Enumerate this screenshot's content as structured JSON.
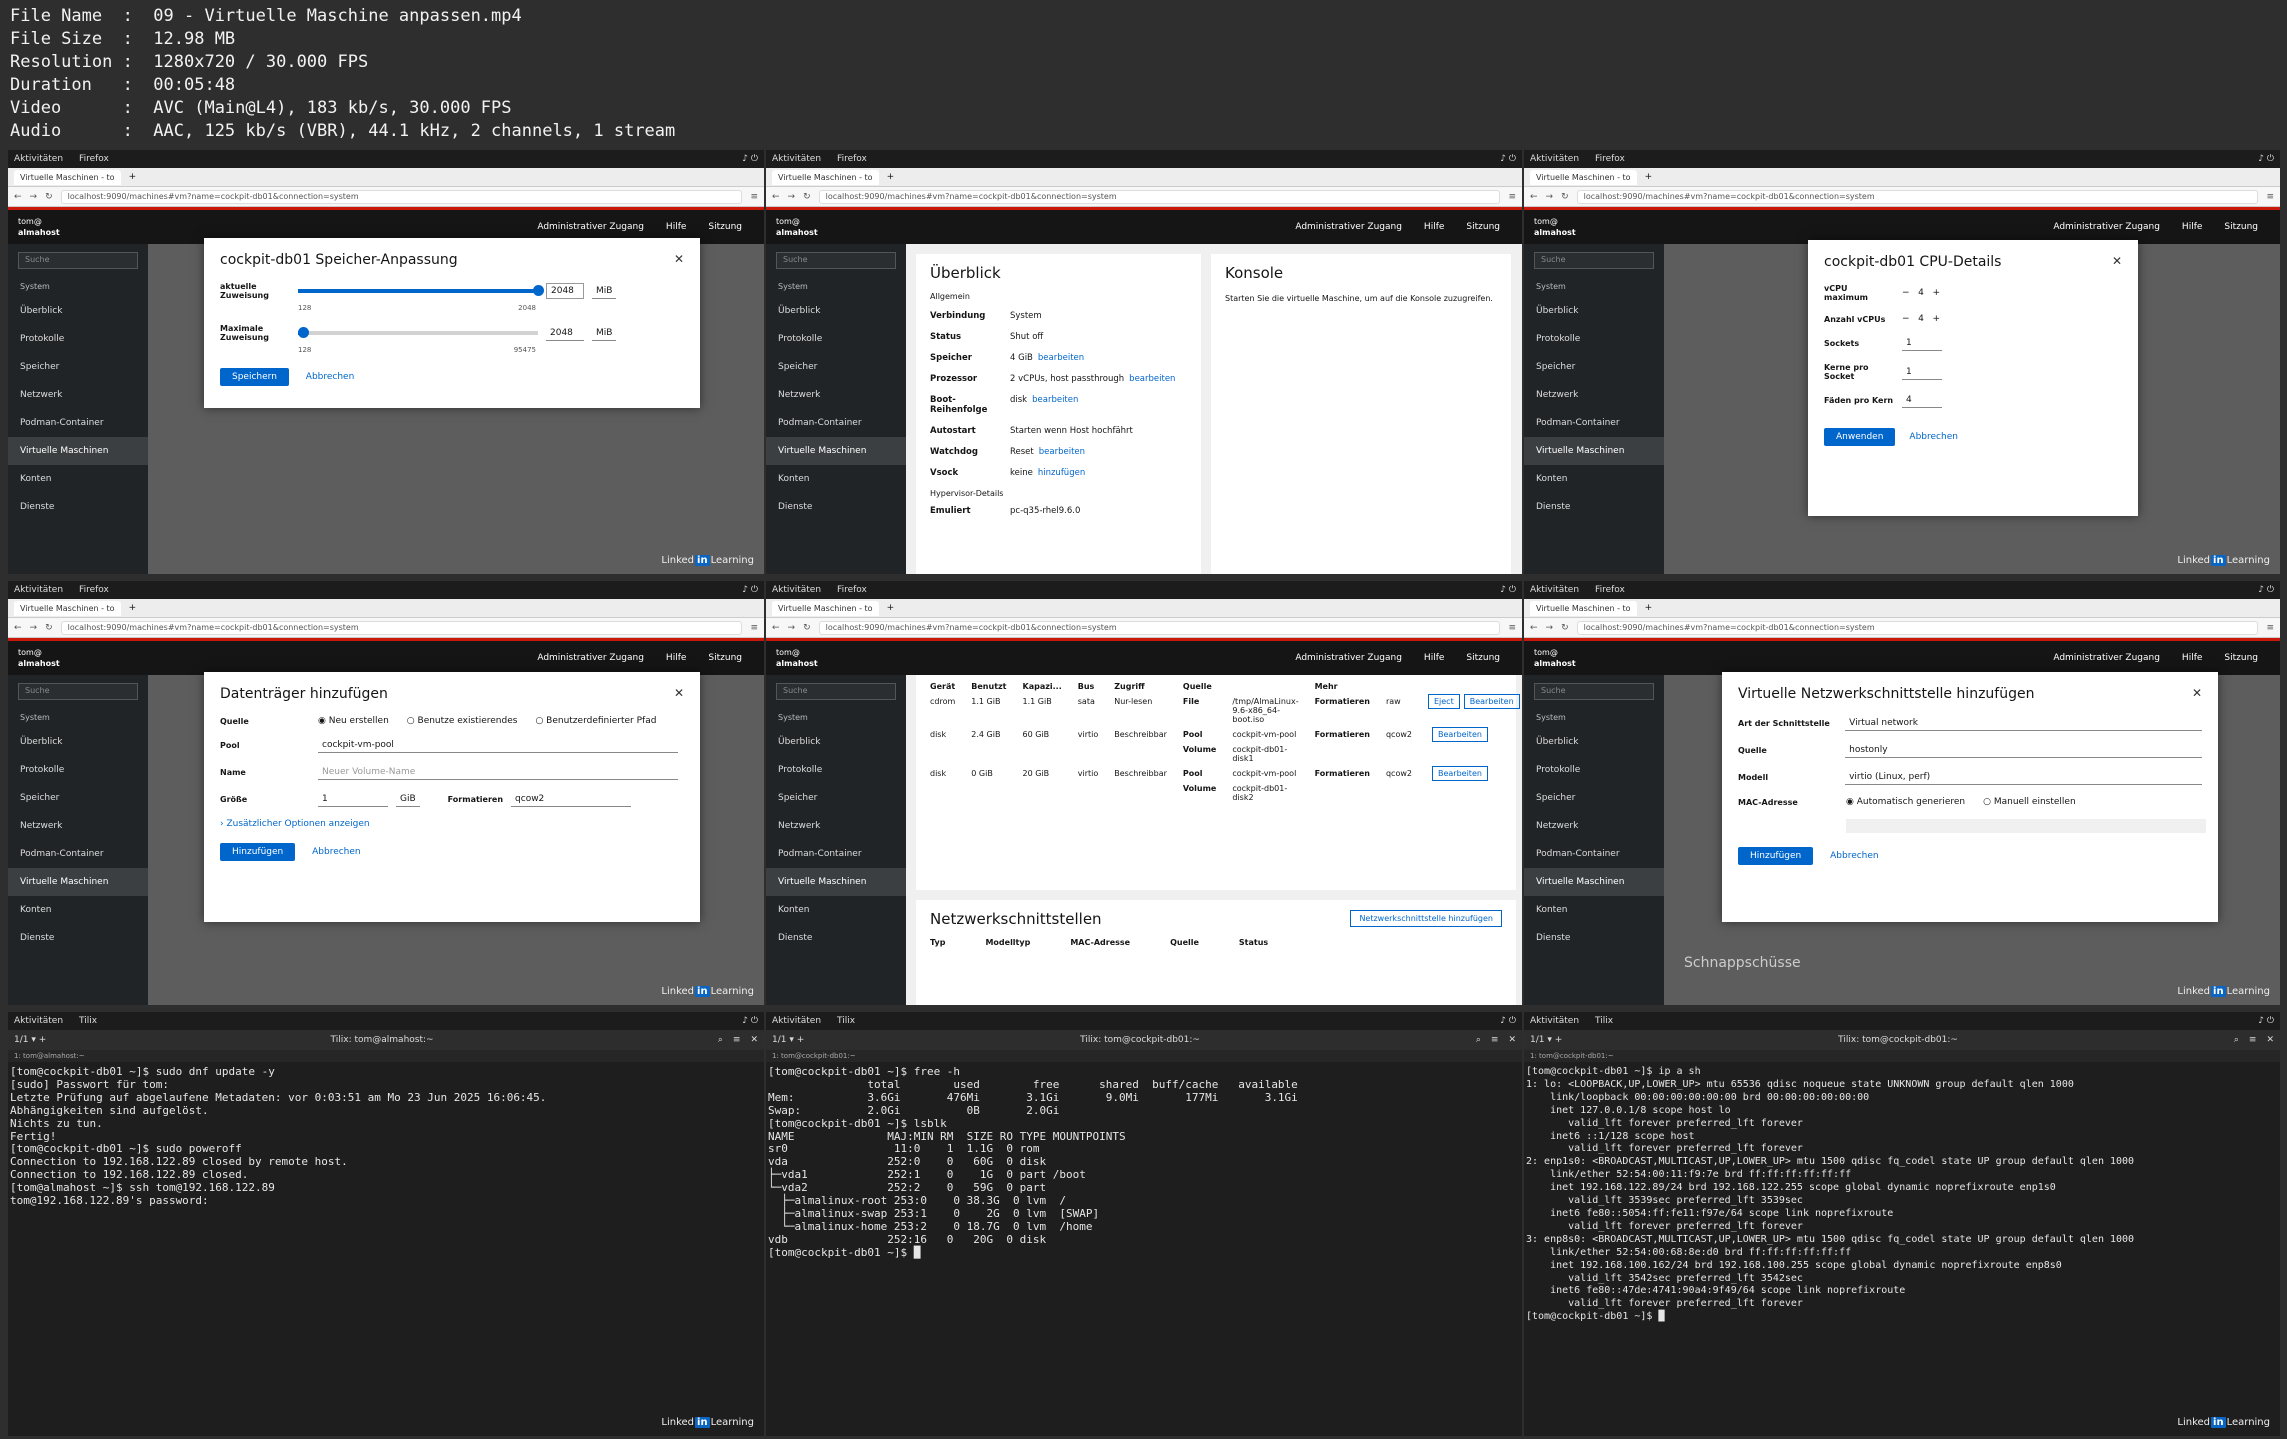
{
  "header": {
    "file_name": "File Name  :  09 - Virtuelle Maschine anpassen.mp4",
    "file_size": "File Size  :  12.98 MB",
    "resolution": "Resolution :  1280x720 / 30.000 FPS",
    "duration": "Duration   :  00:05:48",
    "video": "Video      :  AVC (Main@L4), 183 kb/s, 30.000 FPS",
    "audio": "Audio      :  AAC, 125 kb/s (VBR), 44.1 kHz, 2 channels, 1 stream"
  },
  "common": {
    "activities": "Aktivitäten",
    "firefox": "Firefox",
    "tilix": "Tilix",
    "tab": "Virtuelle Maschinen - to",
    "url": "localhost:9090/machines#vm?name=cockpit-db01&connection=system",
    "user": "tom@",
    "host": "almahost",
    "admin": "Administrativer Zugang",
    "help": "Hilfe",
    "session": "Sitzung",
    "search": "Suche",
    "linkedin": "Linked",
    "in": "in",
    "learning": "Learning",
    "sidebar": [
      "System",
      "Überblick",
      "Protokolle",
      "Speicher",
      "Netzwerk",
      "Podman-Container",
      "Virtuelle Maschinen",
      "Konten",
      "Dienste"
    ]
  },
  "t1": {
    "title": "cockpit-db01 Speicher-Anpassung",
    "current": "aktuelle Zuweisung",
    "current_min": "128",
    "current_max": "2048",
    "current_val": "2048",
    "unit": "MiB",
    "current_fraction": 0.998,
    "maximum": "Maximale Zuweisung",
    "max_min": "128",
    "max_max": "95475",
    "max_val": "2048",
    "max_fraction": 0.02,
    "save": "Speichern",
    "cancel": "Abbrechen"
  },
  "t2": {
    "overview": "Überblick",
    "general": "Allgemein",
    "console": "Konsole",
    "console_text": "Starten Sie die virtuelle Maschine, um auf die Konsole zuzugreifen.",
    "rows": [
      {
        "k": "Verbindung",
        "v": "System",
        "a": ""
      },
      {
        "k": "Status",
        "v": "Shut off",
        "a": ""
      },
      {
        "k": "Speicher",
        "v": "4 GiB",
        "a": "bearbeiten"
      },
      {
        "k": "Prozessor",
        "v": "2 vCPUs, host passthrough",
        "a": "bearbeiten"
      },
      {
        "k": "Boot-Reihenfolge",
        "v": "disk",
        "a": "bearbeiten"
      },
      {
        "k": "Autostart",
        "v": "Starten wenn Host hochfährt",
        "a": ""
      },
      {
        "k": "Watchdog",
        "v": "Reset",
        "a": "bearbeiten"
      },
      {
        "k": "Vsock",
        "v": "keine",
        "a": "hinzufügen"
      }
    ],
    "hyper": "Hypervisor-Details",
    "emul": "Emuliert",
    "emul_v": "pc-q35-rhel9.6.0"
  },
  "t3": {
    "title": "cockpit-db01 CPU-Details",
    "vcpu_max": "vCPU maximum",
    "vcpu_max_v": "4",
    "vcpus": "Anzahl vCPUs",
    "vcpus_v": "4",
    "sockets": "Sockets",
    "sockets_v": "1",
    "cores": "Kerne pro Socket",
    "cores_v": "1",
    "threads": "Fäden pro Kern",
    "threads_v": "4",
    "apply": "Anwenden",
    "cancel": "Abbrechen"
  },
  "t4": {
    "title": "Datenträger hinzufügen",
    "source": "Quelle",
    "opt1": "Neu erstellen",
    "opt2": "Benutze existierendes",
    "opt3": "Benutzerdefinierter Pfad",
    "pool": "Pool",
    "pool_v": "cockpit-vm-pool",
    "name": "Name",
    "name_ph": "Neuer Volume-Name",
    "size": "Größe",
    "size_v": "1",
    "size_unit": "GiB",
    "format": "Formatieren",
    "format_v": "qcow2",
    "more": "Zusätzlicher Optionen anzeigen",
    "add": "Hinzufügen",
    "cancel": "Abbrechen"
  },
  "t5": {
    "cols": [
      "Gerät",
      "Benutzt",
      "Kapazi...",
      "Bus",
      "Zugriff",
      "Quelle",
      "",
      "Mehr"
    ],
    "disks": [
      {
        "dev": "cdrom",
        "used": "1.1 GiB",
        "cap": "1.1 GiB",
        "bus": "sata",
        "acc": "Nur-lesen",
        "src": "File",
        "path": "/tmp/AlmaLinux-9.6-x86_64-boot.iso",
        "fmt": "raw",
        "btn": "Eject"
      },
      {
        "dev": "disk",
        "used": "2.4 GiB",
        "cap": "60 GiB",
        "bus": "virtio",
        "acc": "Beschreibbar",
        "src": "Pool",
        "path": "cockpit-vm-pool",
        "vol": "cockpit-db01-disk1",
        "fmt": "qcow2",
        "btn": ""
      },
      {
        "dev": "disk",
        "used": "0 GiB",
        "cap": "20 GiB",
        "bus": "virtio",
        "acc": "Beschreibbar",
        "src": "Pool",
        "path": "cockpit-vm-pool",
        "vol": "cockpit-db01-disk2",
        "fmt": "qcow2",
        "btn": ""
      }
    ],
    "volume": "Volume",
    "formatieren": "Formatieren",
    "edit": "Bearbeiten",
    "net": "Netzwerkschnittstellen",
    "net_btn": "Netzwerkschnittstelle hinzufügen",
    "net_cols": [
      "Typ",
      "Modelltyp",
      "MAC-Adresse",
      "Quelle",
      "Status"
    ]
  },
  "t6": {
    "title": "Virtuelle Netzwerkschnittstelle hinzufügen",
    "type": "Art der Schnittstelle",
    "type_v": "Virtual network",
    "source": "Quelle",
    "source_v": "hostonly",
    "model": "Modell",
    "model_v": "virtio (Linux, perf)",
    "mac": "MAC-Adresse",
    "mac_auto": "Automatisch generieren",
    "mac_man": "Manuell einstellen",
    "add": "Hinzufügen",
    "cancel": "Abbrechen",
    "snap": "Schnappschüsse"
  },
  "t7": {
    "title": "Tilix: tom@almahost:~",
    "tab": "1: tom@almahost:~",
    "lines": [
      "[tom@cockpit-db01 ~]$ sudo dnf update -y",
      "[sudo] Passwort für tom:",
      "Letzte Prüfung auf abgelaufene Metadaten: vor 0:03:51 am Mo 23 Jun 2025 16:06:45.",
      "Abhängigkeiten sind aufgelöst.",
      "Nichts zu tun.",
      "Fertig!",
      "[tom@cockpit-db01 ~]$ sudo poweroff",
      "Connection to 192.168.122.89 closed by remote host.",
      "Connection to 192.168.122.89 closed.",
      "[tom@almahost ~]$ ssh tom@192.168.122.89",
      "tom@192.168.122.89's password:"
    ]
  },
  "t8": {
    "title": "Tilix: tom@cockpit-db01:~",
    "tab": "1: tom@cockpit-db01:~",
    "lines": [
      "[tom@cockpit-db01 ~]$ free -h",
      "               total        used        free      shared  buff/cache   available",
      "Mem:           3.6Gi       476Mi       3.1Gi       9.0Mi       177Mi       3.1Gi",
      "Swap:          2.0Gi          0B       2.0Gi",
      "[tom@cockpit-db01 ~]$ lsblk",
      "NAME              MAJ:MIN RM  SIZE RO TYPE MOUNTPOINTS",
      "sr0                11:0    1  1.1G  0 rom",
      "vda               252:0    0   60G  0 disk",
      "├─vda1            252:1    0    1G  0 part /boot",
      "└─vda2            252:2    0   59G  0 part",
      "  ├─almalinux-root 253:0    0 38.3G  0 lvm  /",
      "  ├─almalinux-swap 253:1    0    2G  0 lvm  [SWAP]",
      "  └─almalinux-home 253:2    0 18.7G  0 lvm  /home",
      "vdb               252:16   0   20G  0 disk",
      "[tom@cockpit-db01 ~]$ █"
    ]
  },
  "t9": {
    "title": "Tilix: tom@cockpit-db01:~",
    "tab": "1: tom@cockpit-db01:~",
    "lines": [
      "[tom@cockpit-db01 ~]$ ip a sh",
      "1: lo: <LOOPBACK,UP,LOWER_UP> mtu 65536 qdisc noqueue state UNKNOWN group default qlen 1000",
      "    link/loopback 00:00:00:00:00:00 brd 00:00:00:00:00:00",
      "    inet 127.0.0.1/8 scope host lo",
      "       valid_lft forever preferred_lft forever",
      "    inet6 ::1/128 scope host",
      "       valid_lft forever preferred_lft forever",
      "2: enp1s0: <BROADCAST,MULTICAST,UP,LOWER_UP> mtu 1500 qdisc fq_codel state UP group default qlen 1000",
      "    link/ether 52:54:00:11:f9:7e brd ff:ff:ff:ff:ff:ff",
      "    inet 192.168.122.89/24 brd 192.168.122.255 scope global dynamic noprefixroute enp1s0",
      "       valid_lft 3539sec preferred_lft 3539sec",
      "    inet6 fe80::5054:ff:fe11:f97e/64 scope link noprefixroute",
      "       valid_lft forever preferred_lft forever",
      "3: enp8s0: <BROADCAST,MULTICAST,UP,LOWER_UP> mtu 1500 qdisc fq_codel state UP group default qlen 1000",
      "    link/ether 52:54:00:68:8e:d0 brd ff:ff:ff:ff:ff:ff",
      "    inet 192.168.100.162/24 brd 192.168.100.255 scope global dynamic noprefixroute enp8s0",
      "       valid_lft 3542sec preferred_lft 3542sec",
      "    inet6 fe80::47de:4741:90a4:9f49/64 scope link noprefixroute",
      "       valid_lft forever preferred_lft forever",
      "[tom@cockpit-db01 ~]$ █"
    ]
  }
}
